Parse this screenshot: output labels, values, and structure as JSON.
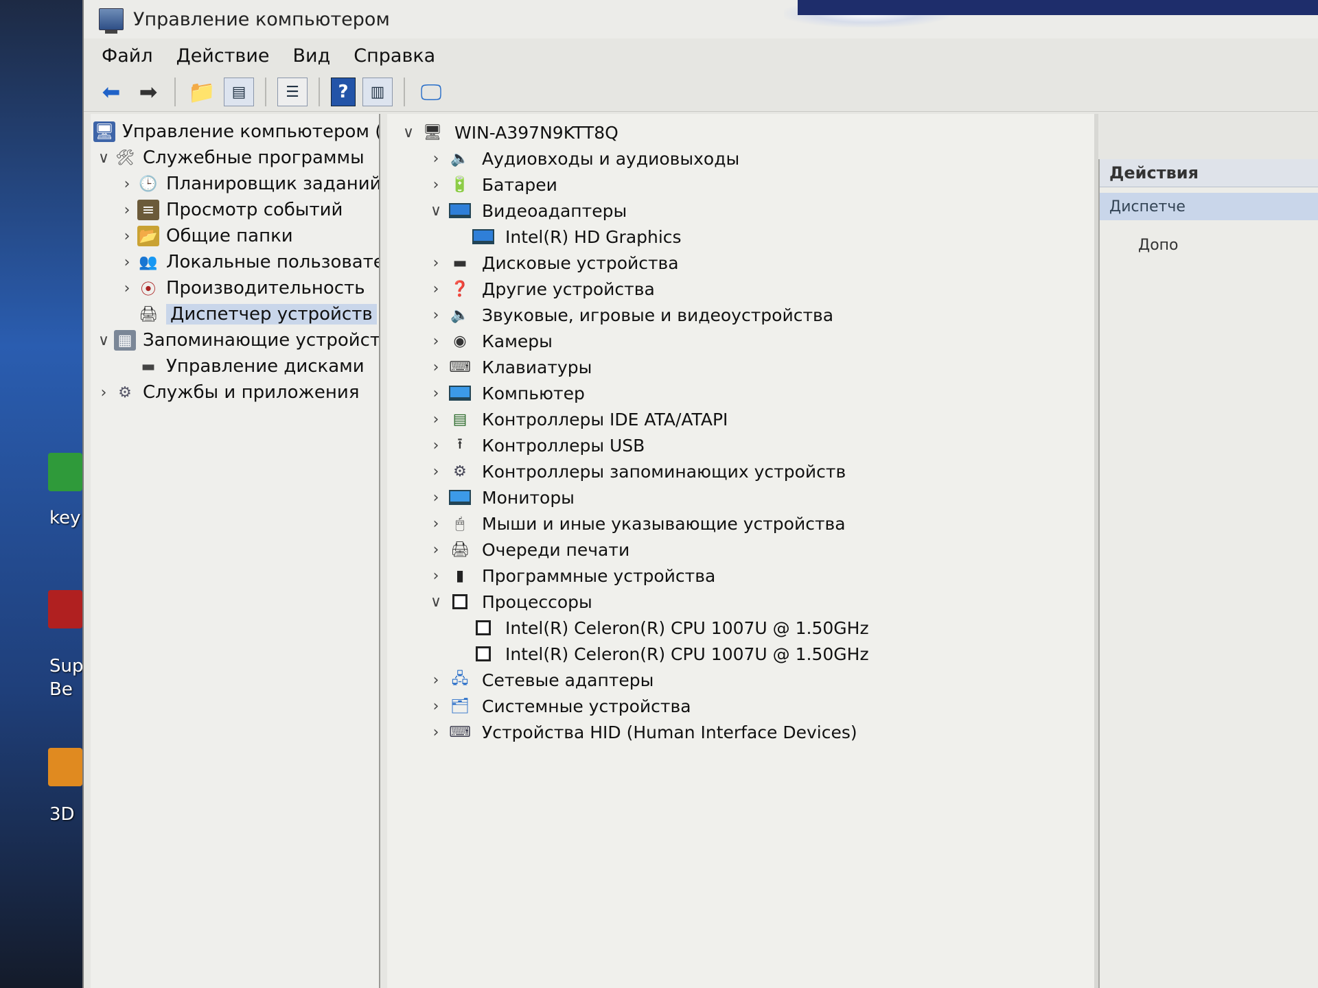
{
  "window": {
    "title": "Управление компьютером"
  },
  "menu": [
    "Файл",
    "Действие",
    "Вид",
    "Справка"
  ],
  "toolbar": {
    "buttons": [
      "back-icon",
      "forward-icon",
      "up-folder-icon",
      "show-hide-tree-icon",
      "properties-icon",
      "help-icon",
      "show-action-pane-icon",
      "scan-hardware-icon"
    ]
  },
  "desktop": {
    "labels": [
      "key",
      "Sup",
      "Be",
      "3D"
    ]
  },
  "tree": {
    "items": [
      {
        "label": "Управление компьютером (л",
        "indent": 0,
        "chevron": "",
        "icon": "computer-management-icon"
      },
      {
        "label": "Служебные программы",
        "indent": 1,
        "chevron": "v",
        "icon": "tools-icon"
      },
      {
        "label": "Планировщик заданий",
        "indent": 2,
        "chevron": ">",
        "icon": "clock-icon"
      },
      {
        "label": "Просмотр событий",
        "indent": 2,
        "chevron": ">",
        "icon": "event-viewer-icon"
      },
      {
        "label": "Общие папки",
        "indent": 2,
        "chevron": ">",
        "icon": "shared-folders-icon"
      },
      {
        "label": "Локальные пользовате",
        "indent": 2,
        "chevron": ">",
        "icon": "users-icon"
      },
      {
        "label": "Производительность",
        "indent": 2,
        "chevron": ">",
        "icon": "performance-icon"
      },
      {
        "label": "Диспетчер устройств",
        "indent": 2,
        "chevron": "",
        "icon": "device-manager-icon",
        "selected": true
      },
      {
        "label": "Запоминающие устройст",
        "indent": 1,
        "chevron": "v",
        "icon": "storage-icon"
      },
      {
        "label": "Управление дисками",
        "indent": 2,
        "chevron": "",
        "icon": "disk-management-icon"
      },
      {
        "label": "Службы и приложения",
        "indent": 1,
        "chevron": ">",
        "icon": "services-icon"
      }
    ]
  },
  "devices": {
    "root": "WIN-A397N9KTT8Q",
    "items": [
      {
        "label": "Аудиовходы и аудиовыходы",
        "level": 1,
        "chevron": ">",
        "icon": "speaker-icon"
      },
      {
        "label": "Батареи",
        "level": 1,
        "chevron": ">",
        "icon": "battery-icon"
      },
      {
        "label": "Видеоадаптеры",
        "level": 1,
        "chevron": "v",
        "icon": "display-adapter-icon"
      },
      {
        "label": "Intel(R) HD Graphics",
        "level": 2,
        "chevron": "",
        "icon": "display-adapter-icon"
      },
      {
        "label": "Дисковые устройства",
        "level": 1,
        "chevron": ">",
        "icon": "disk-drive-icon"
      },
      {
        "label": "Другие устройства",
        "level": 1,
        "chevron": ">",
        "icon": "unknown-device-icon"
      },
      {
        "label": "Звуковые, игровые и видеоустройства",
        "level": 1,
        "chevron": ">",
        "icon": "speaker-icon"
      },
      {
        "label": "Камеры",
        "level": 1,
        "chevron": ">",
        "icon": "camera-icon"
      },
      {
        "label": "Клавиатуры",
        "level": 1,
        "chevron": ">",
        "icon": "keyboard-icon"
      },
      {
        "label": "Компьютер",
        "level": 1,
        "chevron": ">",
        "icon": "monitor-icon"
      },
      {
        "label": "Контроллеры IDE ATA/ATAPI",
        "level": 1,
        "chevron": ">",
        "icon": "ide-controller-icon"
      },
      {
        "label": "Контроллеры USB",
        "level": 1,
        "chevron": ">",
        "icon": "usb-icon"
      },
      {
        "label": "Контроллеры запоминающих устройств",
        "level": 1,
        "chevron": ">",
        "icon": "storage-controller-icon"
      },
      {
        "label": "Мониторы",
        "level": 1,
        "chevron": ">",
        "icon": "monitor-icon"
      },
      {
        "label": "Мыши и иные указывающие устройства",
        "level": 1,
        "chevron": ">",
        "icon": "mouse-icon"
      },
      {
        "label": "Очереди печати",
        "level": 1,
        "chevron": ">",
        "icon": "printer-icon"
      },
      {
        "label": "Программные устройства",
        "level": 1,
        "chevron": ">",
        "icon": "software-device-icon"
      },
      {
        "label": "Процессоры",
        "level": 1,
        "chevron": "v",
        "icon": "processor-icon"
      },
      {
        "label": "Intel(R) Celeron(R) CPU 1007U @ 1.50GHz",
        "level": 2,
        "chevron": "",
        "icon": "processor-icon"
      },
      {
        "label": "Intel(R) Celeron(R) CPU 1007U @ 1.50GHz",
        "level": 2,
        "chevron": "",
        "icon": "processor-icon"
      },
      {
        "label": "Сетевые адаптеры",
        "level": 1,
        "chevron": ">",
        "icon": "network-adapter-icon"
      },
      {
        "label": "Системные устройства",
        "level": 1,
        "chevron": ">",
        "icon": "system-device-icon"
      },
      {
        "label": "Устройства HID (Human Interface Devices)",
        "level": 1,
        "chevron": ">",
        "icon": "hid-icon"
      }
    ]
  },
  "actions": {
    "header": "Действия",
    "selected": "Диспетче",
    "more": "Допо"
  },
  "colors": {
    "window_bg": "#e6e6e2",
    "selection": "#c9d6ea",
    "accent_blue": "#1f62c8"
  }
}
